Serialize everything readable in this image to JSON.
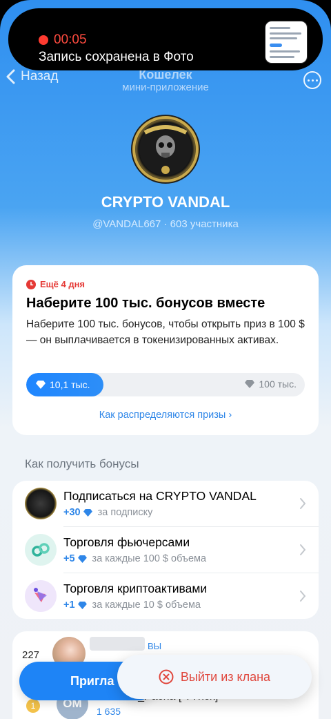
{
  "recording": {
    "time": "00:05",
    "message": "Запись сохранена в Фото"
  },
  "nav": {
    "back_label": "Назад",
    "title": "Кошелек",
    "subtitle": "мини-приложение"
  },
  "clan": {
    "name": "CRYPTO VANDAL",
    "meta": "@VANDAL667 · 603 участника"
  },
  "challenge": {
    "time_left": "Ещё 4 дня",
    "title": "Наберите 100 тыс. бонусов вместе",
    "description": "Наберите 100 тыс. бонусов, чтобы открыть приз в 100 $ — он выплачивается в токенизированных активах.",
    "progress_label": "10,1 тыс.",
    "progress_fraction": 0.101,
    "goal_label": "100 тыс.",
    "prize_link": "Как распределяются призы"
  },
  "ways": {
    "heading": "Как получить бонусы",
    "items": [
      {
        "title": "Подписаться на CRYPTO VANDAL",
        "points": "+30",
        "note": "за подписку",
        "icon": "clan-logo-icon"
      },
      {
        "title": "Торговля фьючерсами",
        "points": "+5",
        "note": "за каждые 100 $ объема",
        "icon": "futures-icon"
      },
      {
        "title": "Торговля криптоактивами",
        "points": "+1",
        "note": "за каждые 10 $ объема",
        "icon": "crypto-assets-icon"
      }
    ]
  },
  "board": {
    "my_rank": "227",
    "you_label": "ВЫ",
    "row2_rank": "1",
    "row2_initials": "OM",
    "row2_name": "OTITOR_Pacha [ TTnck]",
    "row2_score": "1 635"
  },
  "buttons": {
    "invite": "Пригла",
    "leave": "Выйти из клана"
  },
  "colors": {
    "accent": "#2e86e8",
    "danger": "#e0463c"
  }
}
